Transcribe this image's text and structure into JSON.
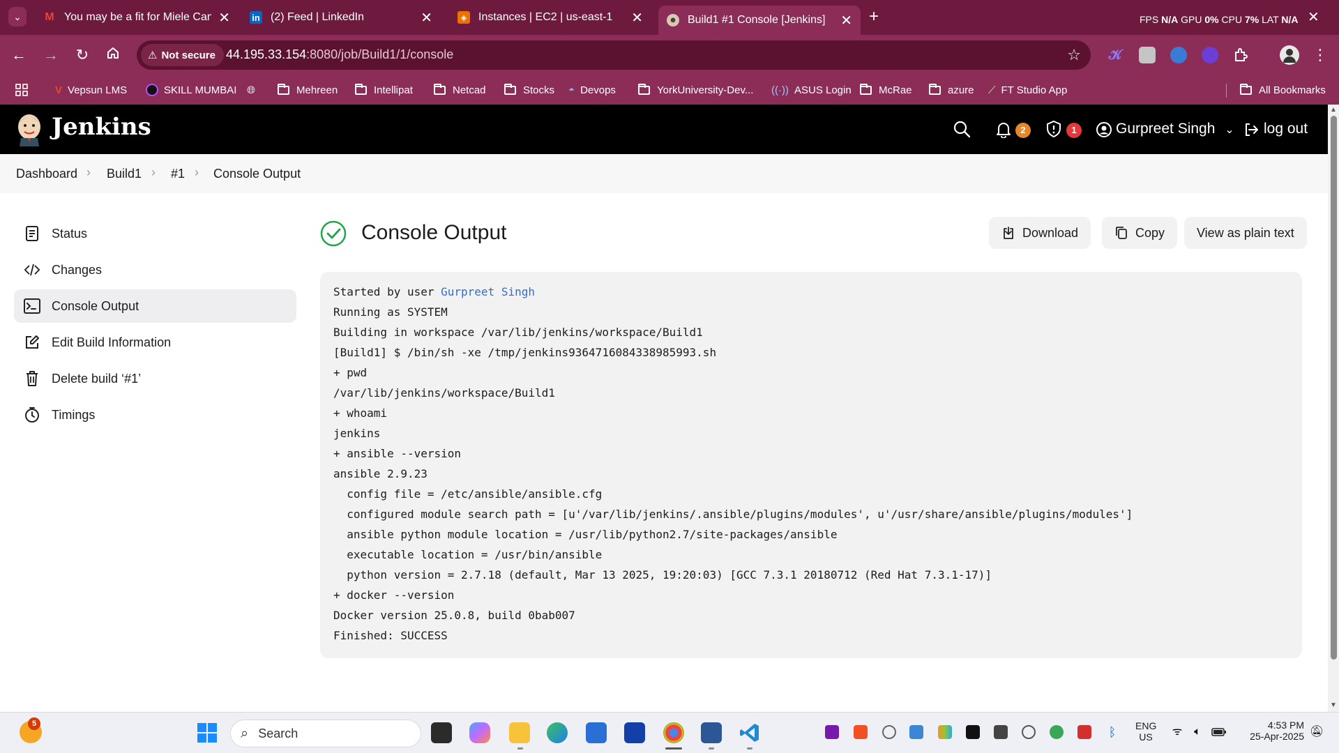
{
  "browser": {
    "tabs": [
      {
        "title": "You may be a fit for Miele Cana",
        "icon": "gmail-icon",
        "close": "✕"
      },
      {
        "title": "(2) Feed | LinkedIn",
        "icon": "linkedin-icon",
        "close": "✕"
      },
      {
        "title": "Instances | EC2 | us-east-1",
        "icon": "aws-icon",
        "close": "✕"
      },
      {
        "title": "Build1 #1 Console [Jenkins]",
        "icon": "jenkins-icon",
        "close": "✕",
        "active": true
      }
    ],
    "new_tab": "+",
    "perf": {
      "fps_label": "FPS",
      "fps": "N/A",
      "gpu_label": "GPU",
      "gpu": "0%",
      "cpu_label": "CPU",
      "cpu": "7%",
      "lat_label": "LAT",
      "lat": "N/A"
    },
    "security_label": "Not secure",
    "url_host": "44.195.33.154",
    "url_rest": ":8080/job/Build1/1/console",
    "bookmarks": [
      {
        "label": "Vepsun LMS",
        "icon": "vepsun-icon"
      },
      {
        "label": "SKILL MUMBAI",
        "icon": "skill-icon"
      },
      {
        "label": "",
        "icon": "globe-icon"
      },
      {
        "label": "Mehreen",
        "icon": "folder-icon"
      },
      {
        "label": "Intellipat",
        "icon": "folder-icon"
      },
      {
        "label": "Netcad",
        "icon": "folder-icon"
      },
      {
        "label": "Stocks",
        "icon": "folder-icon"
      },
      {
        "label": "Devops",
        "icon": "devops-icon"
      },
      {
        "label": "YorkUniversity-Dev...",
        "icon": "folder-icon"
      },
      {
        "label": "ASUS Login",
        "icon": "wifi-icon"
      },
      {
        "label": "McRae",
        "icon": "folder-icon"
      },
      {
        "label": "azure",
        "icon": "folder-icon"
      },
      {
        "label": "FT Studio App",
        "icon": "app-icon"
      }
    ],
    "all_bookmarks": "All Bookmarks"
  },
  "jenkins": {
    "brand": "Jenkins",
    "notifications_count": "2",
    "security_count": "1",
    "user": "Gurpreet Singh",
    "logout": "log out",
    "breadcrumbs": [
      "Dashboard",
      "Build1",
      "#1",
      "Console Output"
    ],
    "sidebar": [
      {
        "label": "Status",
        "icon": "status-icon"
      },
      {
        "label": "Changes",
        "icon": "code-icon"
      },
      {
        "label": "Console Output",
        "icon": "terminal-icon",
        "active": true
      },
      {
        "label": "Edit Build Information",
        "icon": "edit-icon"
      },
      {
        "label": "Delete build ‘#1’",
        "icon": "trash-icon"
      },
      {
        "label": "Timings",
        "icon": "timer-icon"
      }
    ],
    "title": "Console Output",
    "actions": {
      "download": "Download",
      "copy": "Copy",
      "plain": "View as plain text"
    },
    "console": {
      "started_prefix": "Started by user ",
      "started_user": "Gurpreet Singh",
      "lines": [
        "Running as SYSTEM",
        "Building in workspace /var/lib/jenkins/workspace/Build1",
        "[Build1] $ /bin/sh -xe /tmp/jenkins9364716084338985993.sh",
        "+ pwd",
        "/var/lib/jenkins/workspace/Build1",
        "+ whoami",
        "jenkins",
        "+ ansible --version",
        "ansible 2.9.23",
        "  config file = /etc/ansible/ansible.cfg",
        "  configured module search path = [u'/var/lib/jenkins/.ansible/plugins/modules', u'/usr/share/ansible/plugins/modules']",
        "  ansible python module location = /usr/lib/python2.7/site-packages/ansible",
        "  executable location = /usr/bin/ansible",
        "  python version = 2.7.18 (default, Mar 13 2025, 19:20:03) [GCC 7.3.1 20180712 (Red Hat 7.3.1-17)]",
        "+ docker --version",
        "Docker version 25.0.8, build 0bab007",
        "Finished: SUCCESS"
      ]
    }
  },
  "taskbar": {
    "weather_badge": "5",
    "search_placeholder": "Search",
    "lang": "ENG",
    "region": "US",
    "time": "4:53 PM",
    "date": "25-Apr-2025"
  },
  "colors": {
    "chrome_dark": "#6e1a3f",
    "chrome": "#8c2d57",
    "jenkins_header": "#000000",
    "success": "#1ea64b",
    "link": "#2f6fd0",
    "badge_orange": "#e8872a",
    "badge_red": "#e5383b"
  }
}
